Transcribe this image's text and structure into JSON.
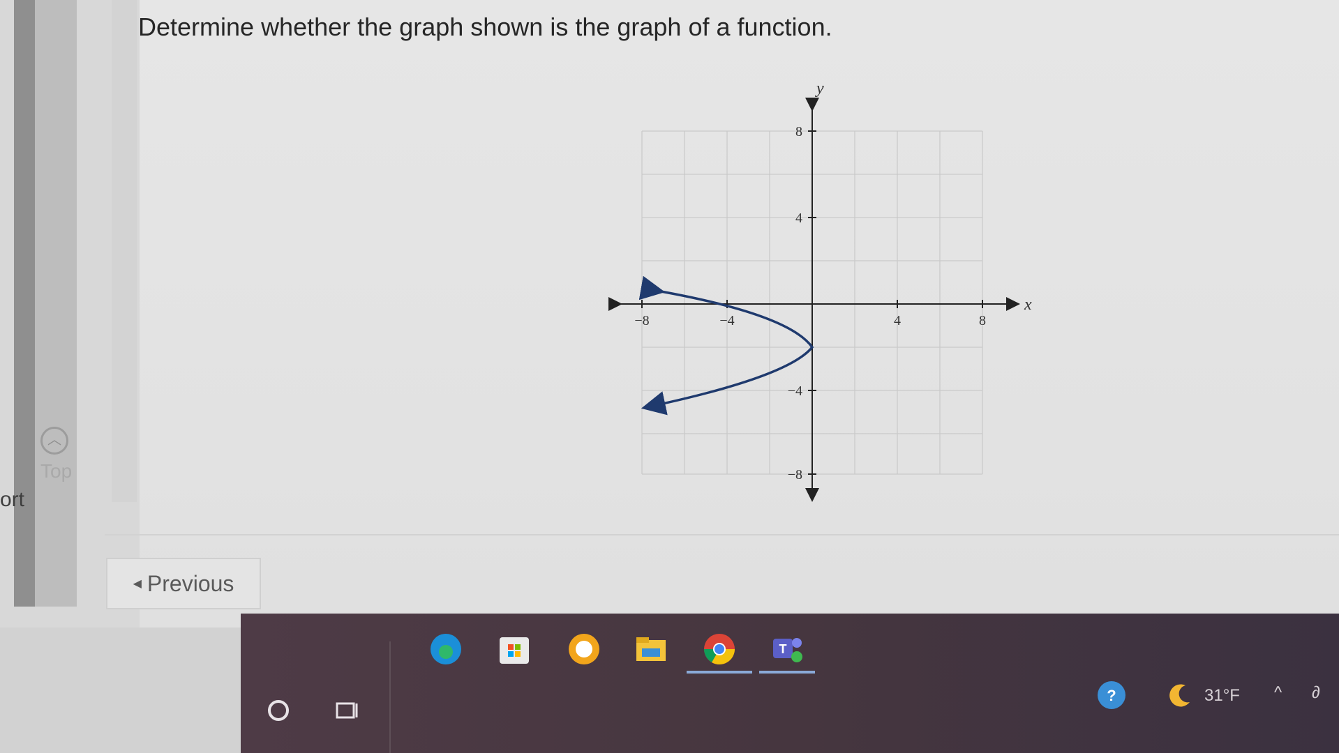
{
  "question": "Determine whether the graph shown is the graph of a function.",
  "nav": {
    "previous_label": "Previous",
    "top_label": "Top",
    "side_fragment": "ort"
  },
  "graph": {
    "x_axis_label": "x",
    "y_axis_label": "y",
    "x_ticks": [
      "−8",
      "−4",
      "4",
      "8"
    ],
    "y_ticks": [
      "8",
      "4",
      "−4",
      "−8"
    ],
    "xlim": [
      -8,
      8
    ],
    "ylim": [
      -8,
      8
    ],
    "grid": true,
    "curve": {
      "type": "sideways-parabola-opening-left",
      "vertex": [
        0,
        -2
      ],
      "arrow_ends": [
        [
          -7.5,
          0.7
        ],
        [
          -7.5,
          -4.7
        ]
      ],
      "color": "#1f3a6e"
    }
  },
  "taskbar": {
    "search_icon": "circle-search-icon",
    "task_view_icon": "task-view-icon",
    "apps": [
      "edge-icon",
      "store-icon",
      "norton-icon",
      "file-explorer-icon",
      "chrome-icon",
      "teams-icon"
    ],
    "weather_temp": "31°F"
  }
}
